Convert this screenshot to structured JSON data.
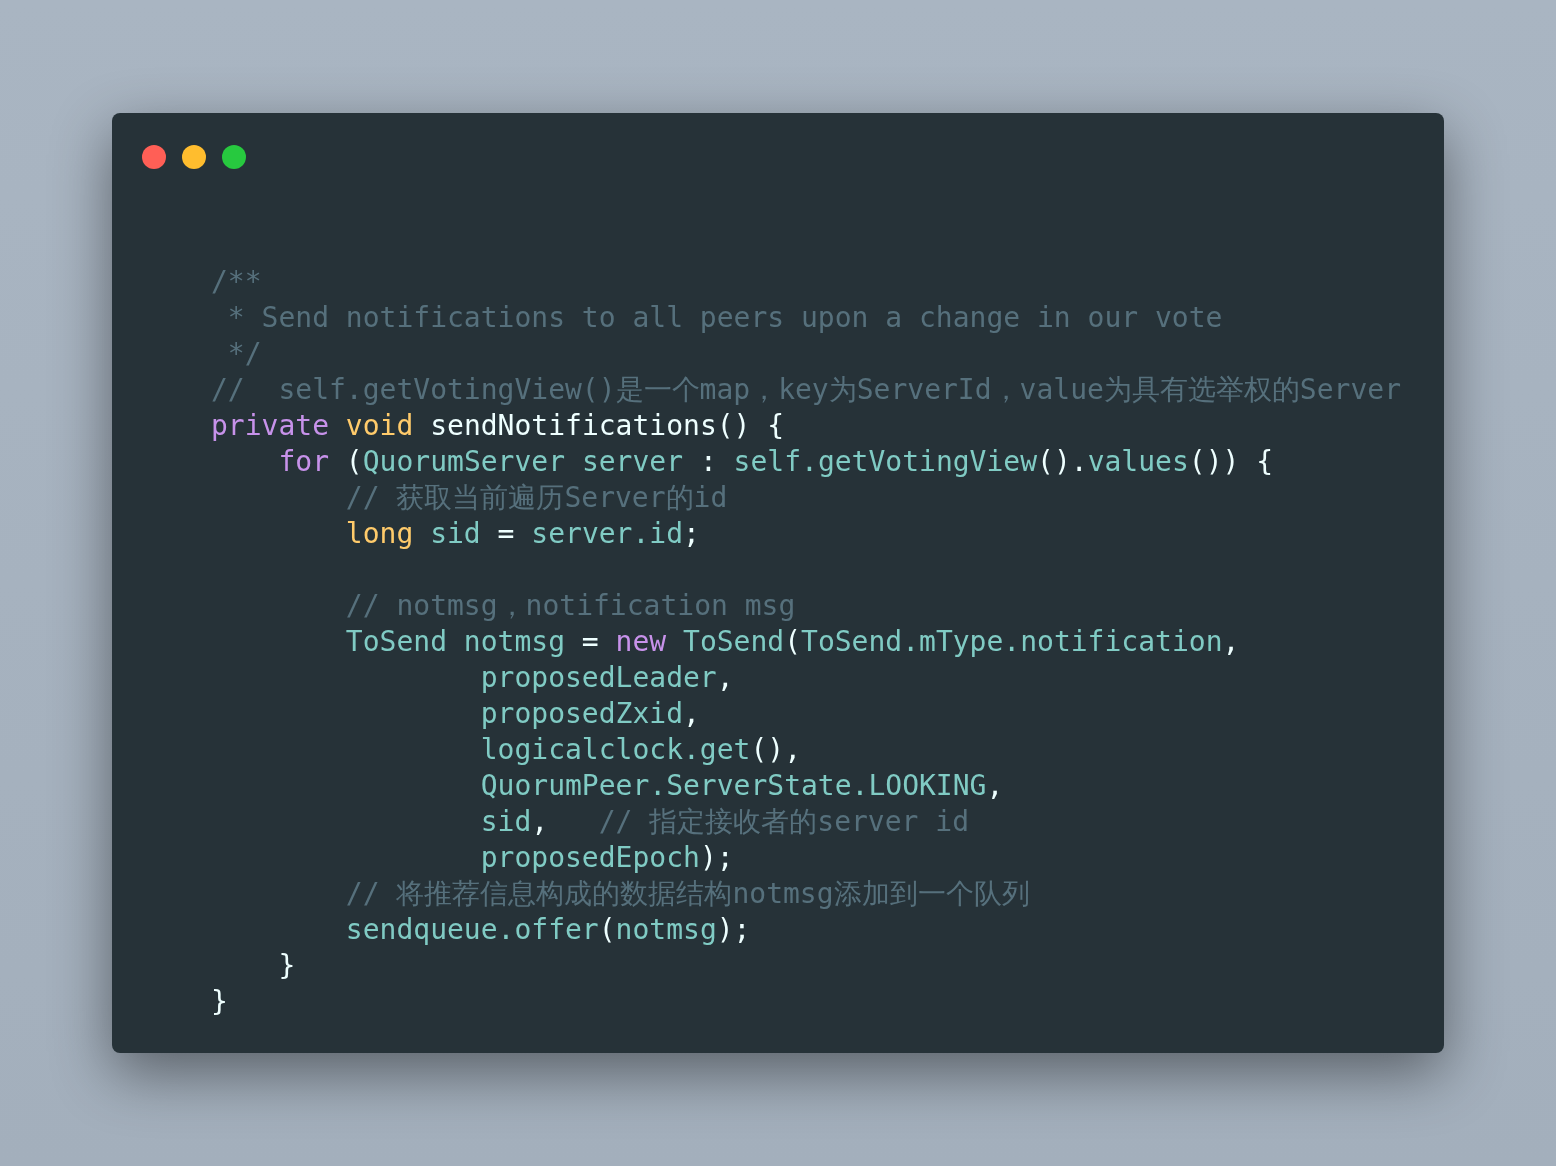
{
  "window": {
    "dots": [
      {
        "color": "#ff5f56"
      },
      {
        "color": "#ffbd2e"
      },
      {
        "color": "#27c93f"
      }
    ]
  },
  "code": {
    "lines": [
      {
        "kind": "code",
        "tokens": [
          {
            "kind": "comment",
            "text": "/**"
          }
        ]
      },
      {
        "kind": "code",
        "tokens": [
          {
            "kind": "comment",
            "text": " * Send notifications to all peers upon a change in our vote"
          }
        ]
      },
      {
        "kind": "code",
        "tokens": [
          {
            "kind": "comment",
            "text": " */"
          }
        ]
      },
      {
        "kind": "code",
        "tokens": [
          {
            "kind": "comment",
            "text": "//  self.getVotingView()是一个map，key为ServerId，value为具有选举权的Server"
          }
        ]
      },
      {
        "kind": "code",
        "tokens": [
          {
            "kind": "keyword",
            "text": "private"
          },
          {
            "kind": "type",
            "text": " void"
          },
          {
            "kind": "punct",
            "text": " sendNotifications() {"
          }
        ]
      },
      {
        "kind": "code",
        "tokens": [
          {
            "kind": "keyword",
            "text": "    for"
          },
          {
            "kind": "punct",
            "text": " ("
          },
          {
            "kind": "ident",
            "text": "QuorumServer server"
          },
          {
            "kind": "punct",
            "text": " : "
          },
          {
            "kind": "ident",
            "text": "self.getVotingView"
          },
          {
            "kind": "punct",
            "text": "()."
          },
          {
            "kind": "ident",
            "text": "values"
          },
          {
            "kind": "punct",
            "text": "()) {"
          }
        ]
      },
      {
        "kind": "code",
        "tokens": [
          {
            "kind": "comment",
            "text": "        // 获取当前遍历Server的id"
          }
        ]
      },
      {
        "kind": "code",
        "tokens": [
          {
            "kind": "type",
            "text": "        long"
          },
          {
            "kind": "ident",
            "text": " sid"
          },
          {
            "kind": "punct",
            "text": " = "
          },
          {
            "kind": "ident",
            "text": "server.id"
          },
          {
            "kind": "punct",
            "text": ";"
          }
        ]
      },
      {
        "kind": "blank"
      },
      {
        "kind": "code",
        "tokens": [
          {
            "kind": "comment",
            "text": "        // notmsg，notification msg"
          }
        ]
      },
      {
        "kind": "code",
        "tokens": [
          {
            "kind": "ident",
            "text": "        ToSend notmsg"
          },
          {
            "kind": "punct",
            "text": " = "
          },
          {
            "kind": "keyword",
            "text": "new"
          },
          {
            "kind": "ident",
            "text": " ToSend"
          },
          {
            "kind": "punct",
            "text": "("
          },
          {
            "kind": "ident",
            "text": "ToSend.mType.notification"
          },
          {
            "kind": "punct",
            "text": ","
          }
        ]
      },
      {
        "kind": "code",
        "tokens": [
          {
            "kind": "ident",
            "text": "                proposedLeader"
          },
          {
            "kind": "punct",
            "text": ","
          }
        ]
      },
      {
        "kind": "code",
        "tokens": [
          {
            "kind": "ident",
            "text": "                proposedZxid"
          },
          {
            "kind": "punct",
            "text": ","
          }
        ]
      },
      {
        "kind": "code",
        "tokens": [
          {
            "kind": "ident",
            "text": "                logicalclock.get"
          },
          {
            "kind": "punct",
            "text": "(),"
          }
        ]
      },
      {
        "kind": "code",
        "tokens": [
          {
            "kind": "ident",
            "text": "                QuorumPeer.ServerState.LOOKING"
          },
          {
            "kind": "punct",
            "text": ","
          }
        ]
      },
      {
        "kind": "code",
        "tokens": [
          {
            "kind": "ident",
            "text": "                sid"
          },
          {
            "kind": "punct",
            "text": ","
          },
          {
            "kind": "comment",
            "text": "   // 指定接收者的server id"
          }
        ]
      },
      {
        "kind": "code",
        "tokens": [
          {
            "kind": "ident",
            "text": "                proposedEpoch"
          },
          {
            "kind": "punct",
            "text": ");"
          }
        ]
      },
      {
        "kind": "code",
        "tokens": [
          {
            "kind": "comment",
            "text": "        // 将推荐信息构成的数据结构notmsg添加到一个队列"
          }
        ]
      },
      {
        "kind": "code",
        "tokens": [
          {
            "kind": "ident",
            "text": "        sendqueue.offer"
          },
          {
            "kind": "punct",
            "text": "("
          },
          {
            "kind": "ident",
            "text": "notmsg"
          },
          {
            "kind": "punct",
            "text": ");"
          }
        ]
      },
      {
        "kind": "code",
        "tokens": [
          {
            "kind": "punct",
            "text": "    }"
          }
        ]
      },
      {
        "kind": "code",
        "tokens": [
          {
            "kind": "punct",
            "text": "}"
          }
        ]
      }
    ]
  }
}
